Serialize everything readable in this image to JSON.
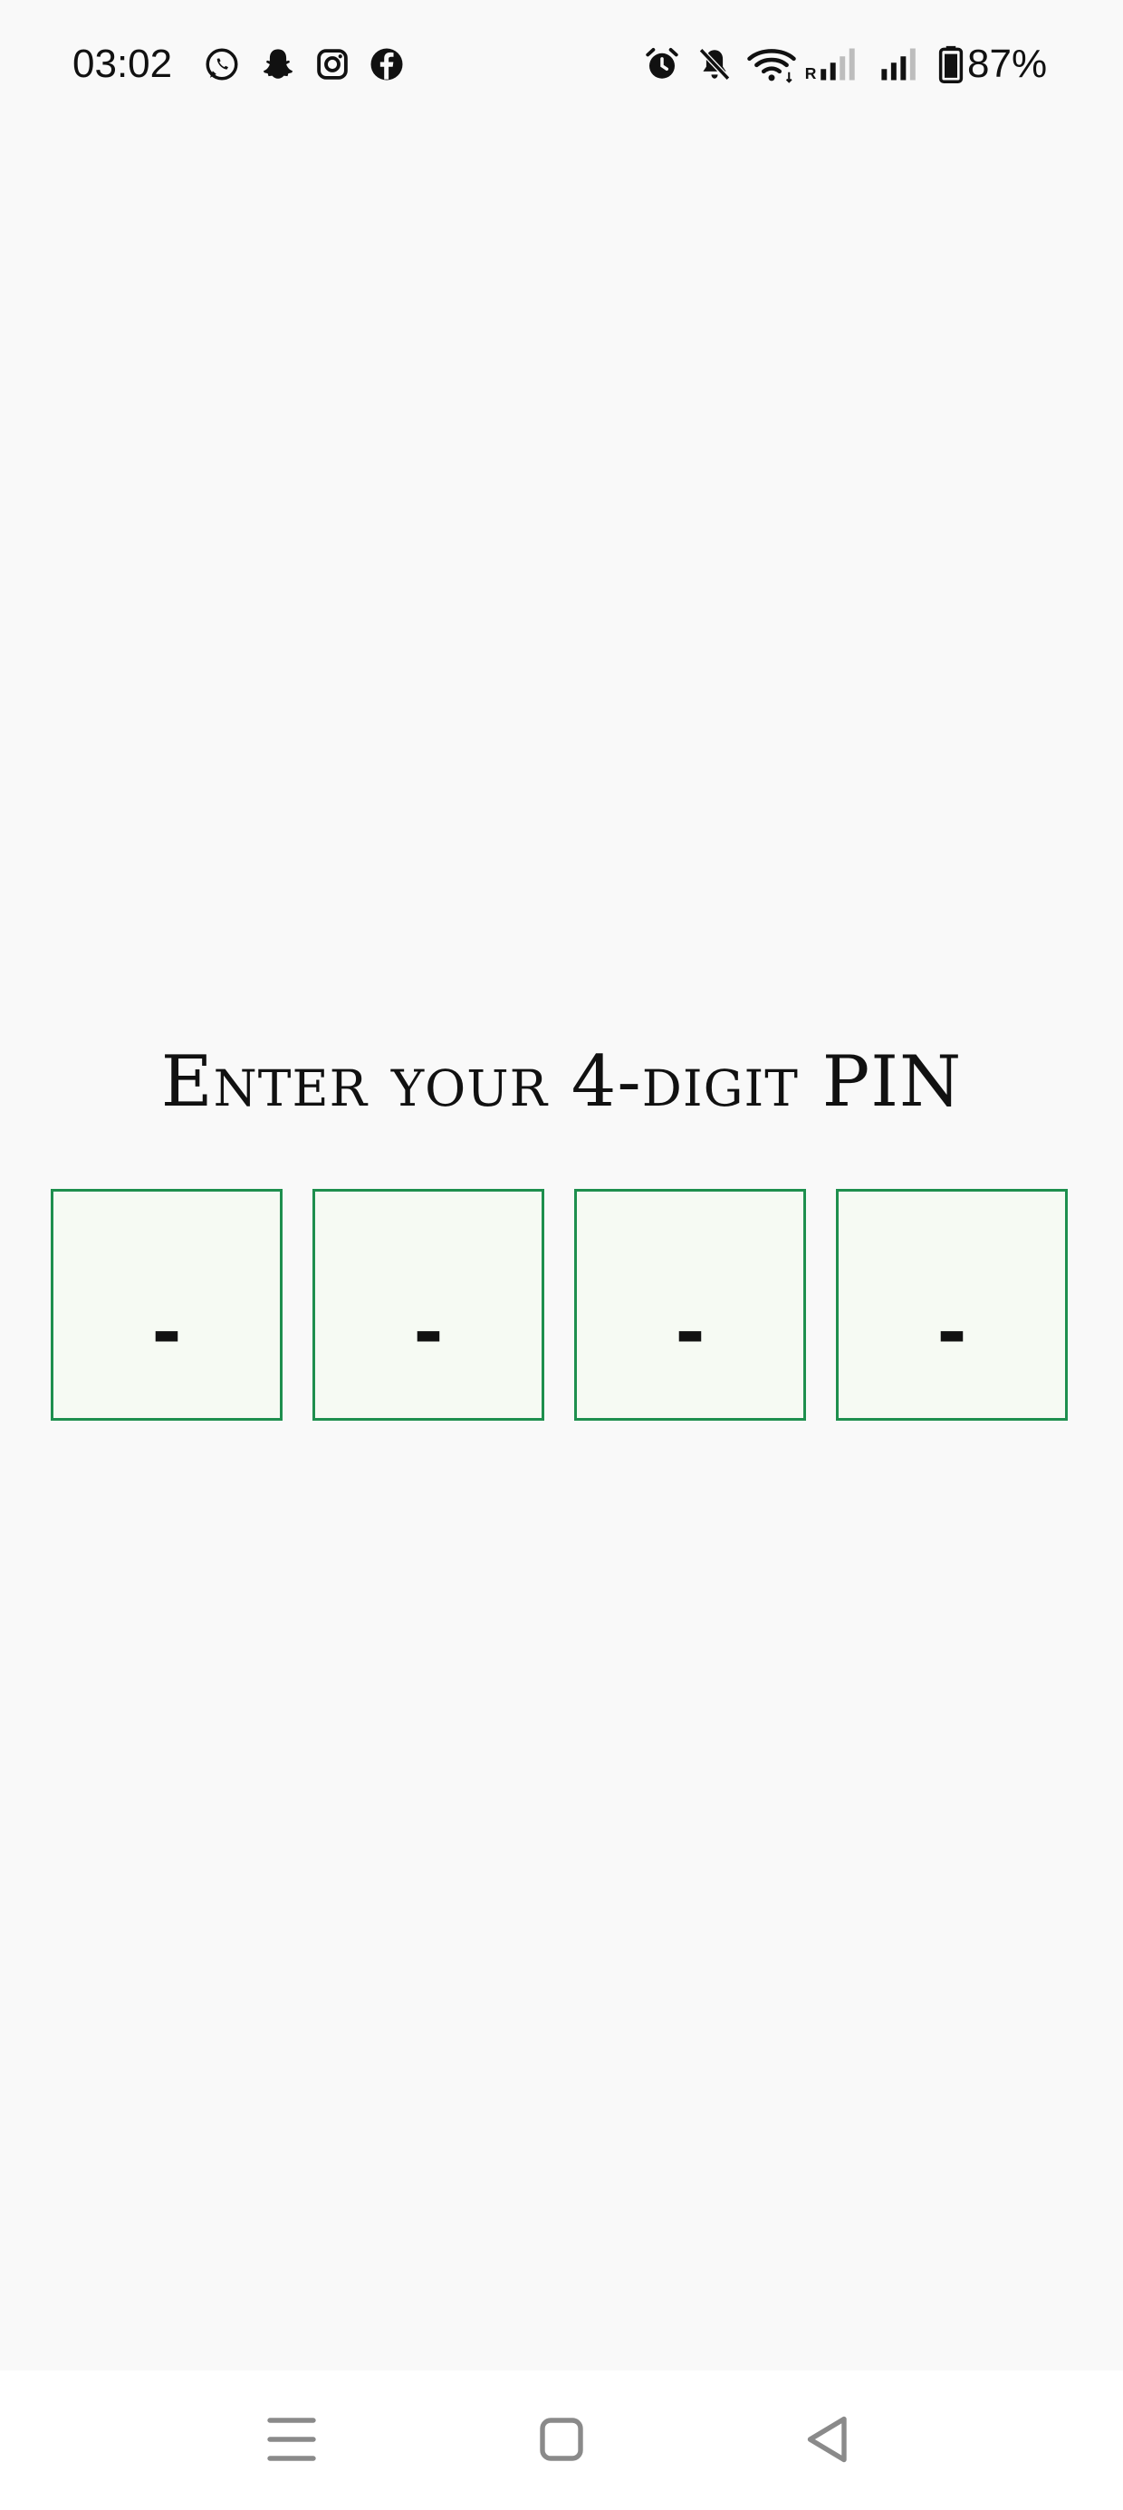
{
  "status_bar": {
    "time": "03:02",
    "notification_icons": [
      "whatsapp-icon",
      "snapchat-icon",
      "instagram-icon",
      "facebook-icon"
    ],
    "system_icons": [
      "alarm-icon",
      "notifications-muted-icon",
      "wifi-icon",
      "signal-roaming-icon",
      "signal-icon",
      "battery-icon"
    ],
    "battery_percent": "87%"
  },
  "pin_entry": {
    "title": "Enter your 4-digit PIN",
    "digits": [
      "-",
      "-",
      "-",
      "-"
    ]
  },
  "navigation_bar": {
    "buttons": [
      "menu-icon",
      "home-icon",
      "back-icon"
    ]
  },
  "colors": {
    "background": "#f9f9f9",
    "pin_border": "#1e8f4e",
    "pin_fill": "#f6faf3",
    "text": "#111111",
    "nav_icon": "#8a8a8a"
  }
}
